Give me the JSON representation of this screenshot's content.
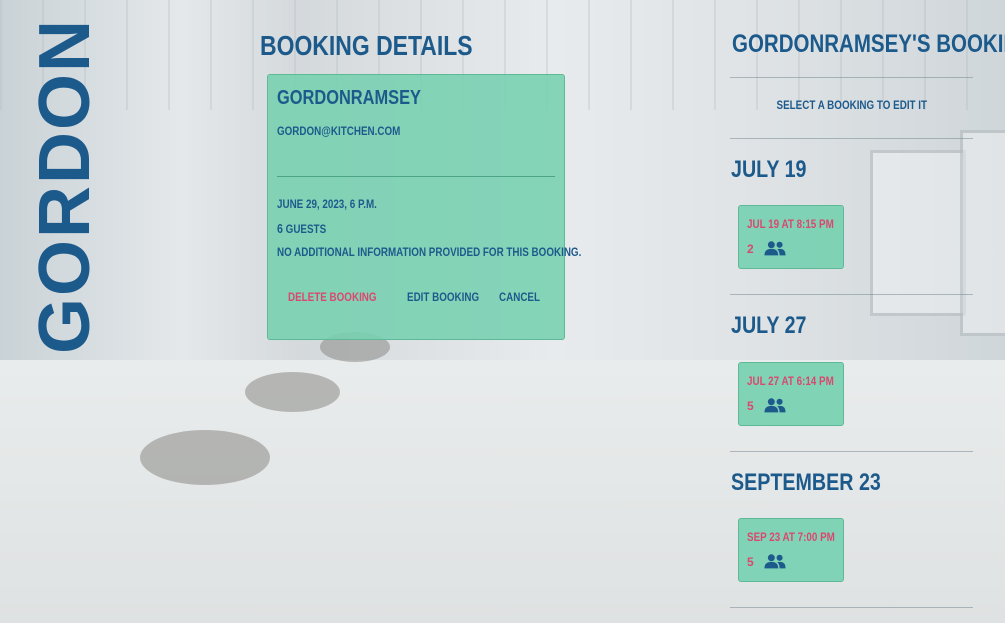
{
  "brand": {
    "name": "GORDON"
  },
  "details": {
    "title": "Booking Details",
    "card": {
      "name": "gordonramsey",
      "email": "gordon@kitchen.com",
      "datetime": "June 29, 2023, 6 p.m.",
      "guests_count": "6",
      "guests_label": "guests",
      "info": "No additional information provided for this booking.",
      "delete_label": "Delete booking",
      "edit_label": "Edit booking",
      "cancel_label": "Cancel"
    }
  },
  "bookings": {
    "title": "gordonramsey's bookings",
    "hint": "Select a booking to edit it",
    "groups": [
      {
        "date": "July 19",
        "time": "Jul 19 at 8:15 PM",
        "guests": "2"
      },
      {
        "date": "July 27",
        "time": "Jul 27 at 6:14 PM",
        "guests": "5"
      },
      {
        "date": "September 23",
        "time": "Sep 23 at 7:00 PM",
        "guests": "5"
      }
    ]
  },
  "colors": {
    "primary": "#1d5a8c",
    "accent": "#d9486f",
    "card": "#76d0b0"
  },
  "icons": {
    "guests": "people-icon"
  }
}
